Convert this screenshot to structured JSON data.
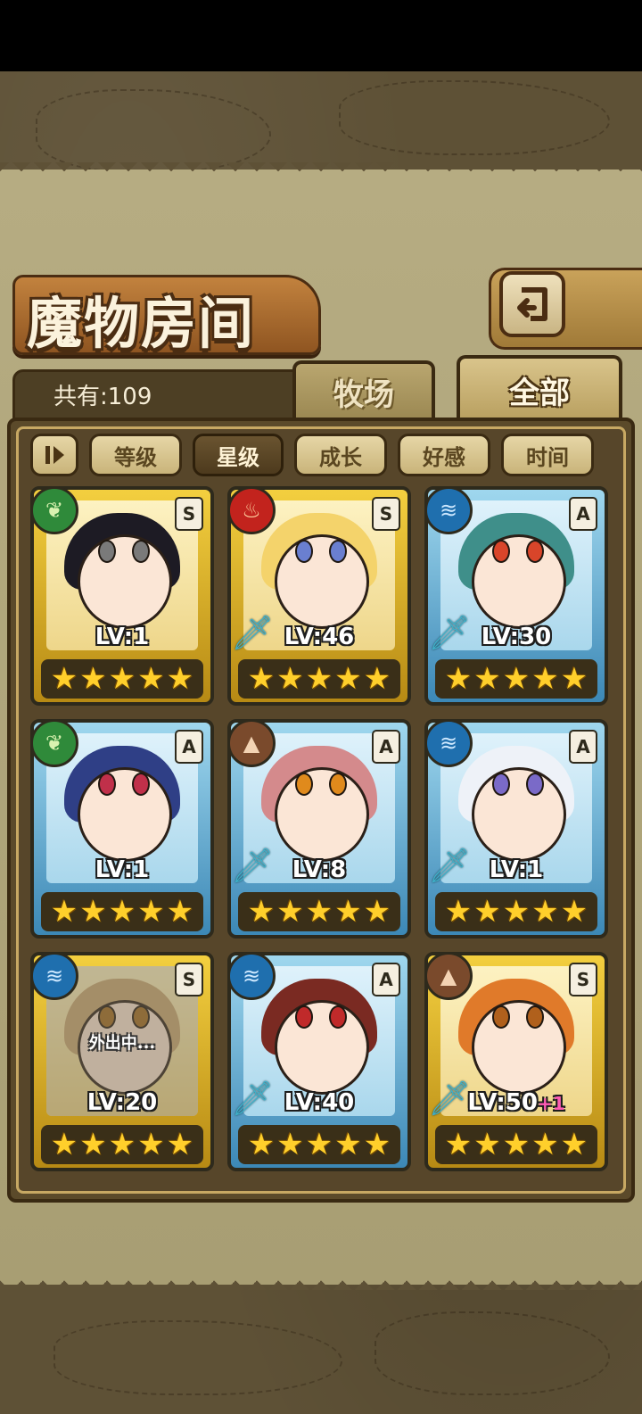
{
  "screen": {
    "title": "魔物房间",
    "count_label": "共有:109"
  },
  "tabs": [
    {
      "label": "牧场",
      "active": false
    },
    {
      "label": "全部",
      "active": true
    }
  ],
  "sort_buttons": [
    {
      "label": "等级",
      "selected": false
    },
    {
      "label": "星级",
      "selected": true
    },
    {
      "label": "成长",
      "selected": false
    },
    {
      "label": "好感",
      "selected": false
    },
    {
      "label": "时间",
      "selected": false
    }
  ],
  "monsters": [
    {
      "element": "grass",
      "rank": "S",
      "level": "LV:1",
      "stars": 5,
      "frame": "gold",
      "weapon": false,
      "hair": "#1d1b24",
      "eye": "#7a7a7a",
      "status": "",
      "bonus": ""
    },
    {
      "element": "fire",
      "rank": "S",
      "level": "LV:46",
      "stars": 5,
      "frame": "gold",
      "weapon": true,
      "hair": "#f4d36b",
      "eye": "#6a7fd0",
      "status": "",
      "bonus": ""
    },
    {
      "element": "water",
      "rank": "A",
      "level": "LV:30",
      "stars": 5,
      "frame": "blue",
      "weapon": true,
      "hair": "#3f8f8a",
      "eye": "#d9452a",
      "status": "",
      "bonus": ""
    },
    {
      "element": "grass",
      "rank": "A",
      "level": "LV:1",
      "stars": 5,
      "frame": "blue",
      "weapon": false,
      "hair": "#2f3f86",
      "eye": "#c0304a",
      "status": "",
      "bonus": ""
    },
    {
      "element": "earth",
      "rank": "A",
      "level": "LV:8",
      "stars": 5,
      "frame": "blue",
      "weapon": true,
      "hair": "#d48a8c",
      "eye": "#e08a1c",
      "status": "",
      "bonus": ""
    },
    {
      "element": "water",
      "rank": "A",
      "level": "LV:1",
      "stars": 5,
      "frame": "blue",
      "weapon": true,
      "hair": "#eef2f8",
      "eye": "#7a6ac8",
      "status": "",
      "bonus": ""
    },
    {
      "element": "water",
      "rank": "S",
      "level": "LV:20",
      "stars": 5,
      "frame": "gold",
      "weapon": false,
      "hair": "#c9a874",
      "eye": "#a06a20",
      "status": "外出中...",
      "bonus": ""
    },
    {
      "element": "water",
      "rank": "A",
      "level": "LV:40",
      "stars": 5,
      "frame": "blue",
      "weapon": true,
      "hair": "#7a2a22",
      "eye": "#c02a2a",
      "status": "",
      "bonus": ""
    },
    {
      "element": "earth",
      "rank": "S",
      "level": "LV:50",
      "stars": 5,
      "frame": "gold",
      "weapon": true,
      "hair": "#e07a2a",
      "eye": "#b0601c",
      "status": "",
      "bonus": "+1"
    }
  ],
  "icons": {
    "back": "back-arrow-icon",
    "toggle": "sort-order-icon",
    "grass": "leaf-icon",
    "fire": "flame-icon",
    "water": "water-wave-icon",
    "earth": "mountain-icon",
    "weapon": "sword-icon",
    "star": "star-icon"
  },
  "colors": {
    "frame_dark": "#3a2a12",
    "panel": "#b6ac82",
    "gold_card": "#f3cf3f",
    "blue_card": "#9fd7ee",
    "star": "#ffcf2b"
  }
}
